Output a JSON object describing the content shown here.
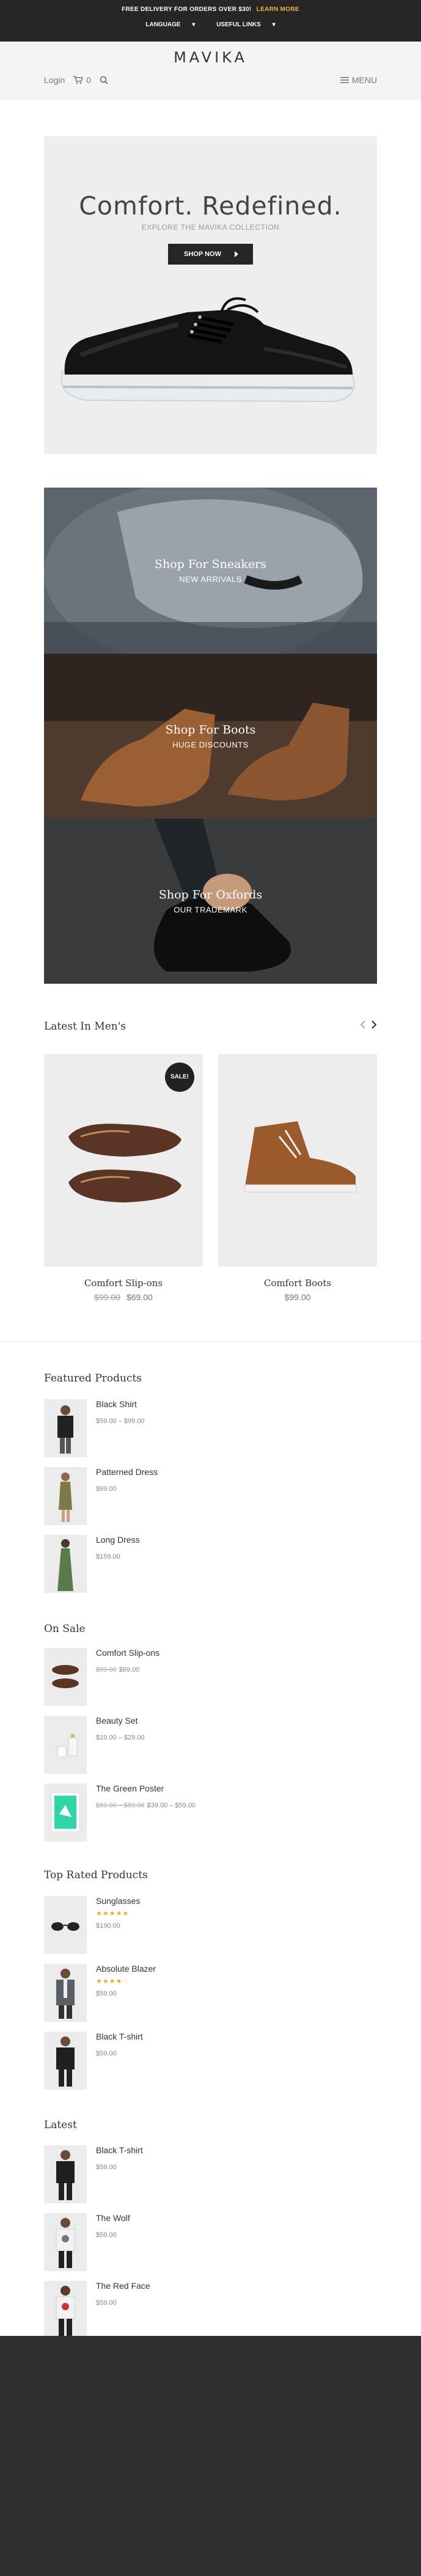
{
  "topbar": {
    "promo_text": "FREE DELIVERY FOR ORDERS OVER $30!",
    "promo_link": "LEARN MORE",
    "language": "LANGUAGE",
    "useful_links": "USEFUL LINKS"
  },
  "header": {
    "logo": "MAVIKA",
    "login": "Login",
    "cart_count": "0",
    "menu": "MENU"
  },
  "hero": {
    "title": "Comfort. Redefined.",
    "subtitle": "EXPLORE THE MAVIKA COLLECTION",
    "button": "SHOP NOW"
  },
  "categories": [
    {
      "title": "Shop For Sneakers",
      "subtitle": "NEW ARRIVALS"
    },
    {
      "title": "Shop For Boots",
      "subtitle": "HUGE DISCOUNTS"
    },
    {
      "title": "Shop For Oxfords",
      "subtitle": "OUR TRADEMARK"
    }
  ],
  "latest_mens": {
    "title": "Latest In Men's",
    "products": [
      {
        "name": "Comfort Slip-ons",
        "old_price": "$99.00",
        "price": "$69.00",
        "badge": "SALE!"
      },
      {
        "name": "Comfort Boots",
        "price": "$99.00"
      }
    ]
  },
  "featured": {
    "title": "Featured Products",
    "items": [
      {
        "name": "Black Shirt",
        "price": "$59.00 – $99.00"
      },
      {
        "name": "Patterned Dress",
        "price": "$99.00"
      },
      {
        "name": "Long Dress",
        "price": "$159.00"
      }
    ]
  },
  "on_sale": {
    "title": "On Sale",
    "items": [
      {
        "name": "Comfort Slip-ons",
        "old_price": "$99.00",
        "price": "$69.00"
      },
      {
        "name": "Beauty Set",
        "price": "$19.00 – $29.00"
      },
      {
        "name": "The Green Poster",
        "old_price": "$69.00 – $89.00",
        "price": "$39.00 – $59.00"
      }
    ]
  },
  "top_rated": {
    "title": "Top Rated Products",
    "items": [
      {
        "name": "Sunglasses",
        "rating": 5,
        "price": "$190.00"
      },
      {
        "name": "Absolute Blazer",
        "rating": 4,
        "price": "$59.00"
      },
      {
        "name": "Black T-shirt",
        "price": "$59.00"
      }
    ]
  },
  "latest": {
    "title": "Latest",
    "items": [
      {
        "name": "Black T-shirt",
        "price": "$59.00"
      },
      {
        "name": "The Wolf",
        "price": "$59.00"
      },
      {
        "name": "The Red Face",
        "price": "$59.00"
      }
    ]
  },
  "colors": {
    "topbar_bg": "#262626",
    "accent_link": "#f2b33d",
    "star": "#e8a92c",
    "footer_bg": "#2f2f2f"
  }
}
